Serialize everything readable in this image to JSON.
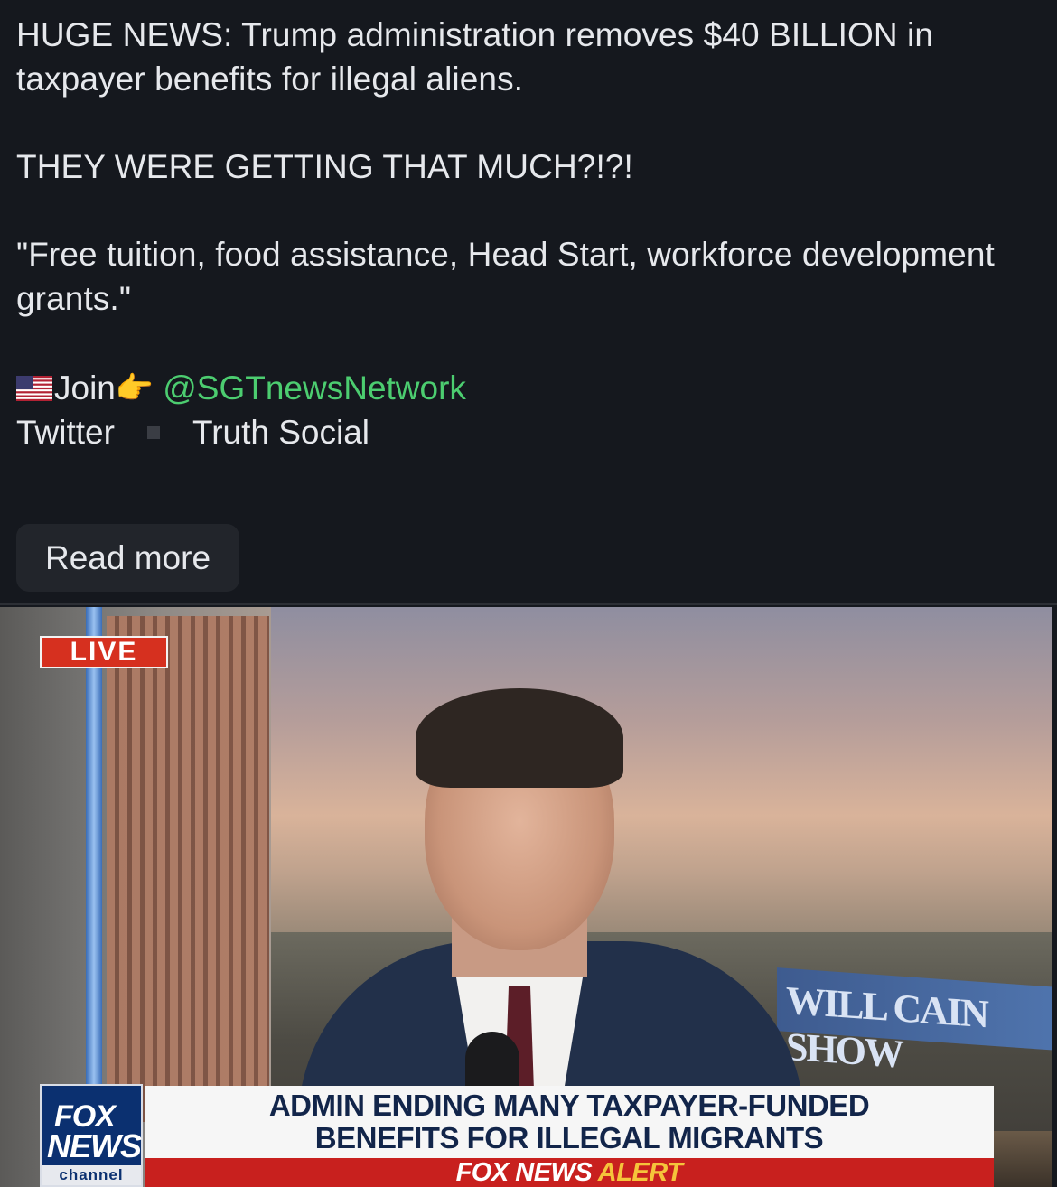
{
  "post": {
    "headline": "HUGE NEWS: Trump administration removes $40 BILLION in taxpayer benefits for illegal aliens.",
    "shout": "THEY WERE GETTING THAT MUCH?!?!",
    "quote": "\"Free tuition, food assistance, Head Start, workforce development grants.\"",
    "join_label": "Join",
    "handle": "@SGTnewsNetwork",
    "link_twitter": "Twitter",
    "link_truth": "Truth Social",
    "read_more": "Read more"
  },
  "icons": {
    "flag": "us-flag-icon",
    "pointer": "pointing-right-hand-icon"
  },
  "colors": {
    "background": "#15181e",
    "text": "#e6e8ec",
    "handle": "#4ccd70",
    "button_bg": "#22252b",
    "live_red": "#d6301f",
    "fox_blue": "#0b3070"
  },
  "video": {
    "live_badge": "LIVE",
    "show_banner": "WILL CAIN SHOW",
    "fox_logo_top": "FOX",
    "fox_logo_bottom": "NEWS",
    "fox_logo_channel": "channel",
    "chyron_line1": "ADMIN ENDING MANY TAXPAYER-FUNDED",
    "chyron_line2": "BENEFITS FOR ILLEGAL MIGRANTS",
    "alert_left": "FOX NEWS",
    "alert_right": "ALERT"
  }
}
